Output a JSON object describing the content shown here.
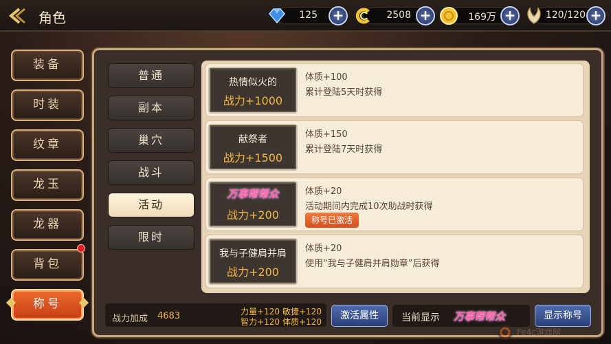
{
  "header": {
    "title": "角色",
    "back_label": "‹"
  },
  "resources": [
    {
      "icon": "diamond-icon",
      "value": "125",
      "color": "#3f8fe8"
    },
    {
      "icon": "swirl-coin-icon",
      "value": "2508",
      "color": "#f2c230"
    },
    {
      "icon": "gold-coin-icon",
      "value": "169万",
      "color": "#f2c230"
    },
    {
      "icon": "stamina-wing-icon",
      "value": "120/120",
      "color": "#e8d9b0"
    }
  ],
  "plus_label": "+",
  "side_tabs": [
    "装备",
    "时装",
    "纹章",
    "龙玉",
    "龙器",
    "背包",
    "称号"
  ],
  "categories": [
    "普通",
    "副本",
    "巢穴",
    "战斗",
    "活动",
    "限时"
  ],
  "titles": [
    {
      "name": "热情似火的",
      "power": "战力+1000",
      "attr": "体质+100",
      "desc": "累计登陆5天时获得"
    },
    {
      "name": "献祭者",
      "power": "战力+1500",
      "attr": "体质+150",
      "desc": "累计登陆7天时获得"
    },
    {
      "name": "万事帮帮众",
      "power": "战力+200",
      "attr": "体质+20",
      "desc": "活动期间内完成10次助战时获得",
      "status": "称号已激活"
    },
    {
      "name": "我与子健肩并肩",
      "power": "战力+200",
      "attr": "体质+20",
      "desc": "使用“我与子健肩并肩勋章”后获得"
    }
  ],
  "footer": {
    "power_label": "战力加成",
    "power_value": "4683",
    "attrs": [
      "力量+120",
      "敏捷+120",
      "智力+120",
      "体质+120"
    ],
    "activate_label": "激活属性",
    "current_label": "当前显示",
    "current_title": "万事帮帮众",
    "show_label": "显示称号"
  },
  "watermark": "Fe4c游戏网"
}
